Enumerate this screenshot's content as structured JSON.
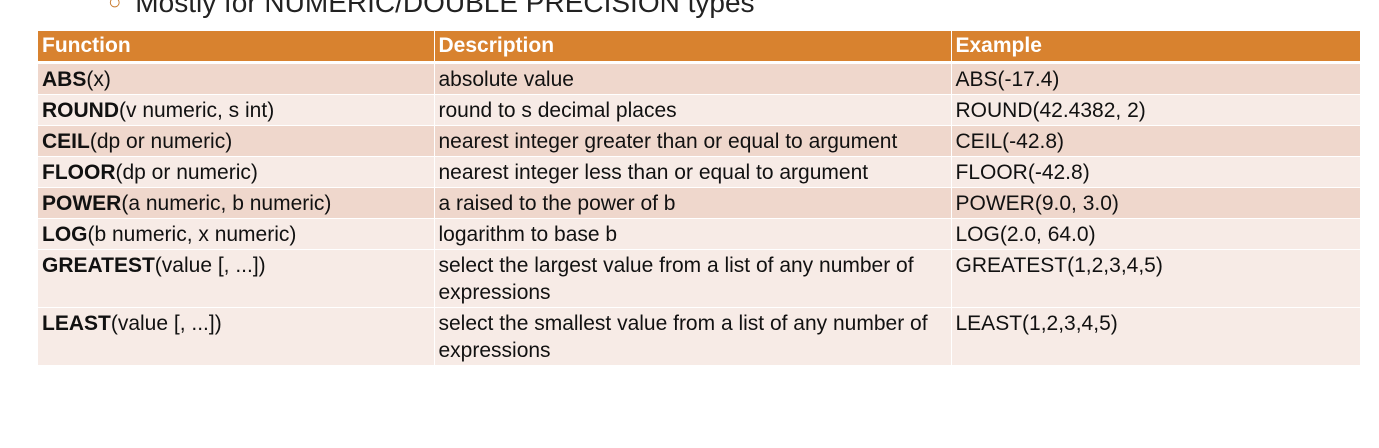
{
  "bullet": {
    "text": "Mostly for NUMERIC/DOUBLE PRECISION types"
  },
  "table": {
    "headers": [
      "Function",
      "Description",
      "Example"
    ],
    "rows": [
      {
        "name": "ABS",
        "args": "(x)",
        "description": "absolute value",
        "example": "ABS(-17.4)"
      },
      {
        "name": "ROUND",
        "args": "(v numeric, s int)",
        "description": "round to s decimal places",
        "example": "ROUND(42.4382, 2)"
      },
      {
        "name": "CEIL",
        "args": "(dp or numeric)",
        "description": "nearest integer greater than or equal to argument",
        "example": "CEIL(-42.8)"
      },
      {
        "name": "FLOOR",
        "args": "(dp or numeric)",
        "description": "nearest integer less than or equal to argument",
        "example": "FLOOR(-42.8)"
      },
      {
        "name": "POWER",
        "args": "(a numeric, b numeric)",
        "description": "a raised to the power of b",
        "example": "POWER(9.0, 3.0)"
      },
      {
        "name": "LOG",
        "args": "(b numeric, x numeric)",
        "description": "logarithm to base b",
        "example": "LOG(2.0, 64.0)"
      },
      {
        "name": "GREATEST",
        "args": "(value [, ...])",
        "description": "select the largest value from a list of any number of expressions",
        "example": "GREATEST(1,2,3,4,5)"
      },
      {
        "name": "LEAST",
        "args": "(value [, ...])",
        "description": "select the smallest value from a list of any number of expressions",
        "example": "LEAST(1,2,3,4,5)"
      }
    ]
  }
}
